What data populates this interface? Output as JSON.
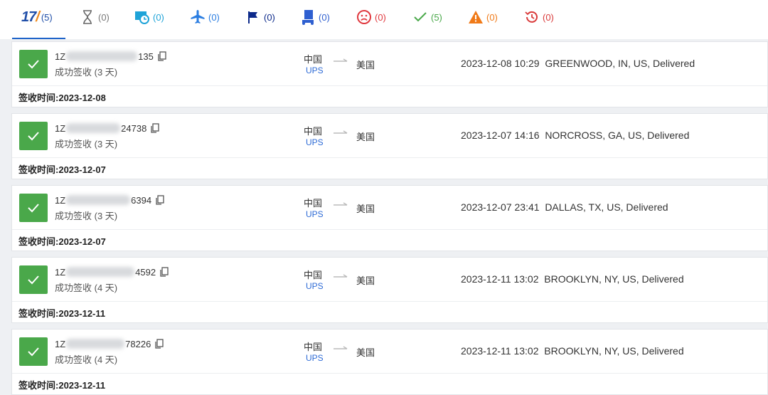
{
  "tabs": [
    {
      "name": "tab-all",
      "icon": "17track-logo",
      "count": "(5)",
      "color": "#1f4ea8"
    },
    {
      "name": "tab-not-found",
      "icon": "hourglass-icon",
      "count": "(0)",
      "color": "#666666"
    },
    {
      "name": "tab-in-transit-timer",
      "icon": "truck-clock-icon",
      "count": "(0)",
      "color": "#1ea3d8"
    },
    {
      "name": "tab-in-transit",
      "icon": "airplane-icon",
      "count": "(0)",
      "color": "#2a7de1"
    },
    {
      "name": "tab-pick-up",
      "icon": "flag-icon",
      "count": "(0)",
      "color": "#0d2a8a"
    },
    {
      "name": "tab-out-for-delivery",
      "icon": "courier-icon",
      "count": "(0)",
      "color": "#2e5fd0"
    },
    {
      "name": "tab-undelivered",
      "icon": "sad-face-icon",
      "count": "(0)",
      "color": "#e0383e"
    },
    {
      "name": "tab-delivered",
      "icon": "check-icon",
      "count": "(5)",
      "color": "#4aa84a"
    },
    {
      "name": "tab-alert",
      "icon": "warning-icon",
      "count": "(0)",
      "color": "#f07a18"
    },
    {
      "name": "tab-expired",
      "icon": "history-icon",
      "count": "(0)",
      "color": "#d93a3a"
    }
  ],
  "logo": {
    "text": "17",
    "slash": "/"
  },
  "shipments": [
    {
      "tracking_prefix": "1Z",
      "tracking_suffix": "135",
      "status": "成功签收 (3 天)",
      "origin": "中国",
      "carrier": "UPS",
      "destination": "美国",
      "latest_event": "2023-12-08 10:29  GREENWOOD, IN, US, Delivered",
      "signed_label": "签收时间:",
      "signed_date": "2023-12-08"
    },
    {
      "tracking_prefix": "1Z",
      "tracking_suffix": "24738",
      "status": "成功签收 (3 天)",
      "origin": "中国",
      "carrier": "UPS",
      "destination": "美国",
      "latest_event": "2023-12-07 14:16  NORCROSS, GA, US, Delivered",
      "signed_label": "签收时间:",
      "signed_date": "2023-12-07"
    },
    {
      "tracking_prefix": "1Z",
      "tracking_suffix": "6394",
      "status": "成功签收 (3 天)",
      "origin": "中国",
      "carrier": "UPS",
      "destination": "美国",
      "latest_event": "2023-12-07 23:41  DALLAS, TX, US, Delivered",
      "signed_label": "签收时间:",
      "signed_date": "2023-12-07"
    },
    {
      "tracking_prefix": "1Z",
      "tracking_suffix": "4592",
      "status": "成功签收 (4 天)",
      "origin": "中国",
      "carrier": "UPS",
      "destination": "美国",
      "latest_event": "2023-12-11 13:02  BROOKLYN, NY, US, Delivered",
      "signed_label": "签收时间:",
      "signed_date": "2023-12-11"
    },
    {
      "tracking_prefix": "1Z",
      "tracking_suffix": "78226",
      "status": "成功签收 (4 天)",
      "origin": "中国",
      "carrier": "UPS",
      "destination": "美国",
      "latest_event": "2023-12-11 13:02  BROOKLYN, NY, US, Delivered",
      "signed_label": "签收时间:",
      "signed_date": "2023-12-11"
    }
  ]
}
